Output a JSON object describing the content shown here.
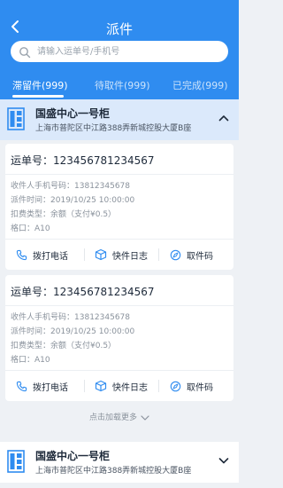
{
  "header": {
    "title": "派件"
  },
  "search": {
    "placeholder": "请输入运单号/手机号"
  },
  "tabs": [
    {
      "label": "滞留件(999)",
      "active": true
    },
    {
      "label": "待取件(999)",
      "active": false
    },
    {
      "label": "已完成(999)",
      "active": false
    }
  ],
  "groups": [
    {
      "title": "国盛中心一号柜",
      "address": "上海市普陀区中江路388弄新城控股大厦B座",
      "expanded": true
    },
    {
      "title": "国盛中心一号柜",
      "address": "上海市普陀区中江路388弄新城控股大厦B座",
      "expanded": false
    }
  ],
  "cards": [
    {
      "tracking_label": "运单号：",
      "tracking_no": "123456781234567",
      "phone_label": "收件人手机号码：",
      "phone": "13812345678",
      "time_label": "派件时间：",
      "time": "2019/10/25  10:00:00",
      "fee_label": "扣费类型：",
      "fee": "余额（支付¥0.5）",
      "cell_label": "格口：",
      "cell": "A10"
    },
    {
      "tracking_label": "运单号：",
      "tracking_no": "123456781234567",
      "phone_label": "收件人手机号码：",
      "phone": "13812345678",
      "time_label": "派件时间：",
      "time": "2019/10/25  10:00:00",
      "fee_label": "扣费类型：",
      "fee": "余额（支付¥0.5）",
      "cell_label": "格口：",
      "cell": "A10"
    }
  ],
  "actions": {
    "call": "拨打电话",
    "log": "快件日志",
    "code": "取件码"
  },
  "load_more": "点击加载更多",
  "colors": {
    "primary": "#2f8cf0",
    "group_bg": "#dbe9fb",
    "page_bg": "#eef1f5"
  }
}
